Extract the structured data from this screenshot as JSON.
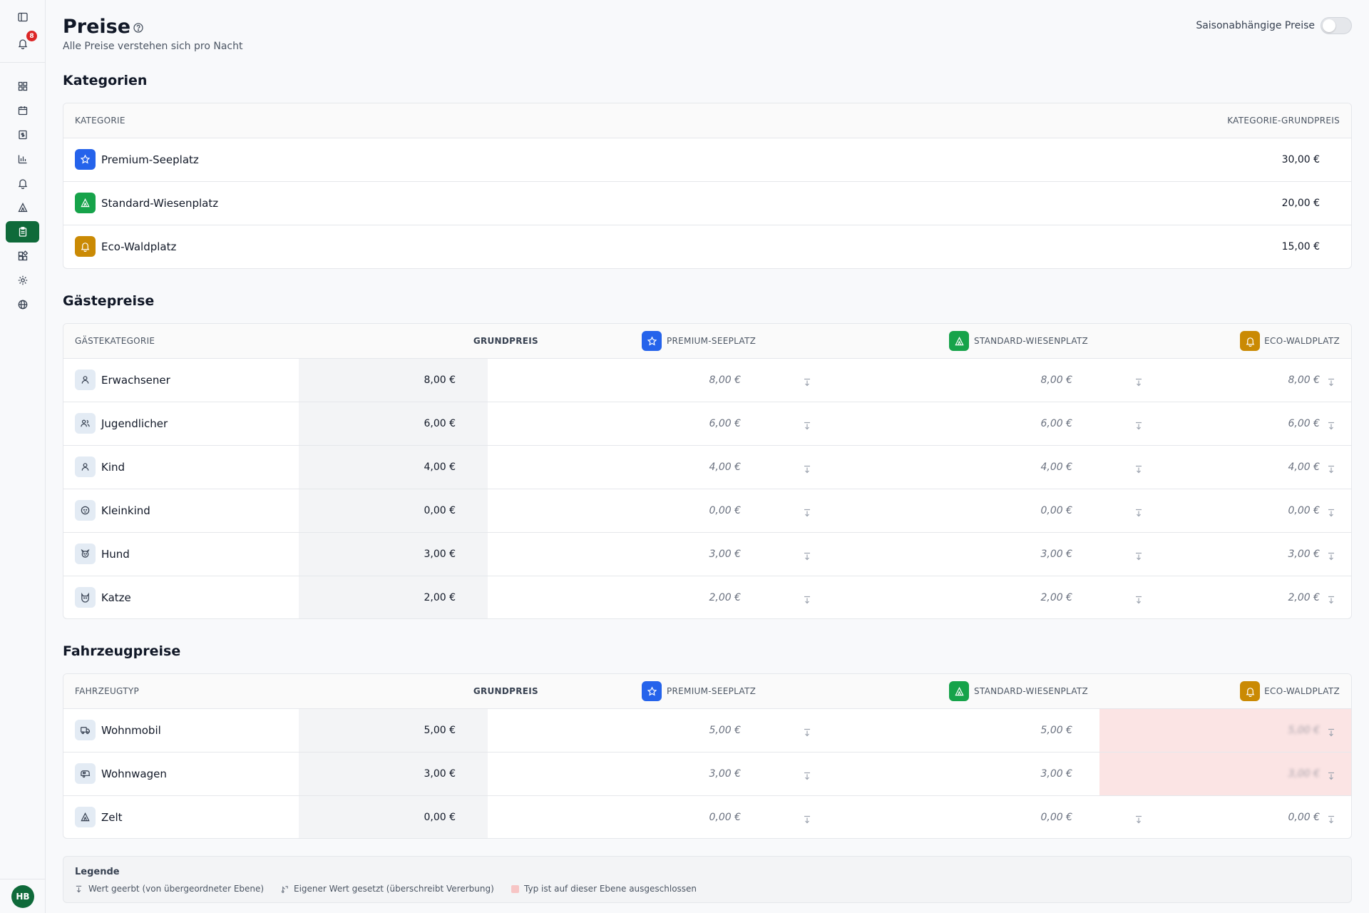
{
  "sidebar": {
    "notification_count": "8",
    "avatar_initials": "HB",
    "items": [
      "sidebar-toggle-icon",
      "bell-icon",
      "dashboard-icon",
      "calendar-icon",
      "invoice-icon",
      "chart-icon",
      "alarm-icon",
      "tent-icon",
      "clipboard-icon",
      "modules-icon",
      "settings-icon",
      "globe-icon"
    ]
  },
  "header": {
    "title": "Preise",
    "subtitle": "Alle Preise verstehen sich pro Nacht",
    "seasonal_label": "Saisonabhängige Preise",
    "seasonal_enabled": false
  },
  "categories": {
    "section_title": "Kategorien",
    "col_category": "KATEGORIE",
    "col_base_price": "KATEGORIE-GRUNDPREIS",
    "rows": [
      {
        "name": "Premium-Seeplatz",
        "price": "30,00 €",
        "color": "#2563eb",
        "icon": "star-icon"
      },
      {
        "name": "Standard-Wiesenplatz",
        "price": "20,00 €",
        "color": "#16a34a",
        "icon": "tent-icon"
      },
      {
        "name": "Eco-Waldplatz",
        "price": "15,00 €",
        "color": "#ca8a04",
        "icon": "bell-icon"
      }
    ]
  },
  "guests": {
    "section_title": "Gästepreise",
    "col_name": "GÄSTEKATEGORIE",
    "col_base": "GRUNDPREIS",
    "col_premium": "PREMIUM-SEEPLATZ",
    "col_standard": "STANDARD-WIESENPLATZ",
    "col_eco": "ECO-WALDPLATZ",
    "rows": [
      {
        "name": "Erwachsener",
        "icon": "person-icon",
        "base": "8,00 €",
        "premium": "8,00 €",
        "standard": "8,00 €",
        "eco": "8,00 €"
      },
      {
        "name": "Jugendlicher",
        "icon": "people-icon",
        "base": "6,00 €",
        "premium": "6,00 €",
        "standard": "6,00 €",
        "eco": "6,00 €"
      },
      {
        "name": "Kind",
        "icon": "child-icon",
        "base": "4,00 €",
        "premium": "4,00 €",
        "standard": "4,00 €",
        "eco": "4,00 €"
      },
      {
        "name": "Kleinkind",
        "icon": "baby-icon",
        "base": "0,00 €",
        "premium": "0,00 €",
        "standard": "0,00 €",
        "eco": "0,00 €"
      },
      {
        "name": "Hund",
        "icon": "dog-icon",
        "base": "3,00 €",
        "premium": "3,00 €",
        "standard": "3,00 €",
        "eco": "3,00 €"
      },
      {
        "name": "Katze",
        "icon": "cat-icon",
        "base": "2,00 €",
        "premium": "2,00 €",
        "standard": "2,00 €",
        "eco": "2,00 €"
      }
    ]
  },
  "vehicles": {
    "section_title": "Fahrzeugpreise",
    "col_name": "FAHRZEUGTYP",
    "col_base": "GRUNDPREIS",
    "col_premium": "PREMIUM-SEEPLATZ",
    "col_standard": "STANDARD-WIESENPLATZ",
    "col_eco": "ECO-WALDPLATZ",
    "rows": [
      {
        "name": "Wohnmobil",
        "icon": "motorhome-icon",
        "base": "5,00 €",
        "premium": "5,00 €",
        "standard": "5,00 €",
        "eco": "5,00 €",
        "eco_excluded": true
      },
      {
        "name": "Wohnwagen",
        "icon": "caravan-icon",
        "base": "3,00 €",
        "premium": "3,00 €",
        "standard": "3,00 €",
        "eco": "3,00 €",
        "eco_excluded": true
      },
      {
        "name": "Zelt",
        "icon": "tent-icon",
        "base": "0,00 €",
        "premium": "0,00 €",
        "standard": "0,00 €",
        "eco": "0,00 €",
        "eco_excluded": false
      }
    ]
  },
  "legend": {
    "title": "Legende",
    "inherited": "Wert geerbt (von übergeordneter Ebene)",
    "overridden": "Eigener Wert gesetzt (überschreibt Vererbung)",
    "excluded": "Typ ist auf dieser Ebene ausgeschlossen"
  },
  "colors": {
    "accent": "#0f6a3a",
    "premium": "#2563eb",
    "standard": "#16a34a",
    "eco": "#ca8a04",
    "excluded": "#fbe4e4"
  }
}
